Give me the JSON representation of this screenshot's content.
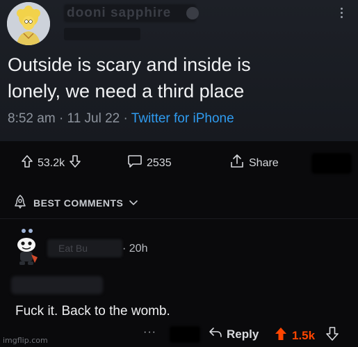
{
  "tweet": {
    "author_name": "dooni sapphire",
    "text": "Outside is scary and inside is\nlonely, we need a third place",
    "time": "8:52 am",
    "date": "11 Jul 22",
    "source": "Twitter for iPhone",
    "separator": "·"
  },
  "post_actions": {
    "upvotes": "53.2k",
    "comments": "2535",
    "share_label": "Share"
  },
  "sort": {
    "label": "BEST COMMENTS"
  },
  "comment": {
    "username": "Eat Bu",
    "age": "20h",
    "text": "Fuck it. Back to the womb.",
    "more": "···",
    "reply_label": "Reply",
    "score": "1.5k"
  },
  "watermark": "imgflip.com",
  "colors": {
    "accent_upvote": "#ff4500",
    "link_blue": "#2f9bf0",
    "background": "#0a0a0c"
  },
  "icons": [
    "kebab-icon",
    "upvote-arrow-icon",
    "downvote-arrow-icon",
    "comment-bubble-icon",
    "share-icon",
    "rocket-badge-icon",
    "chevron-down-icon",
    "reply-arrow-icon"
  ]
}
